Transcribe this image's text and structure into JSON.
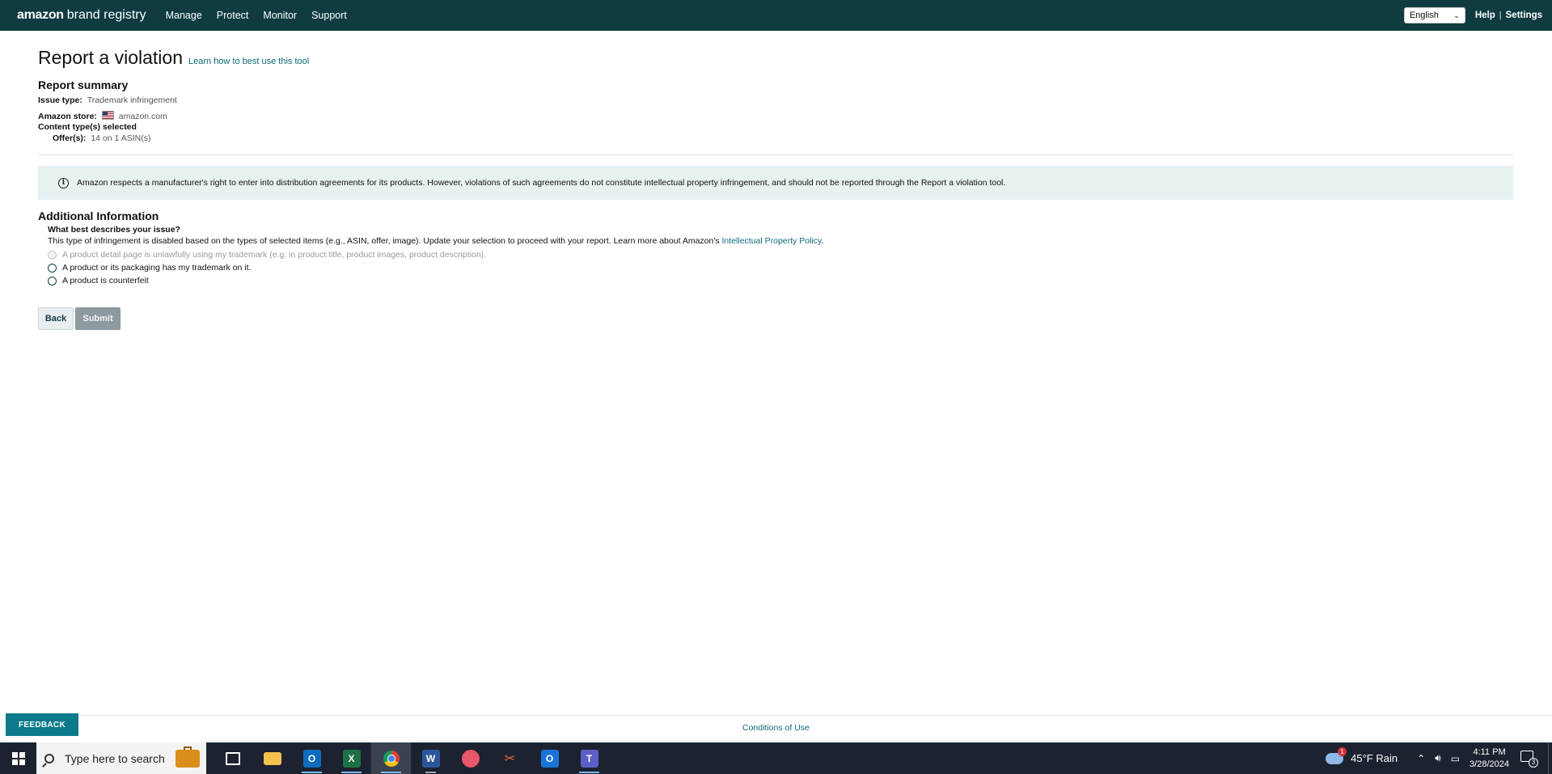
{
  "header": {
    "logo_main": "amazon",
    "logo_rest": "brand registry",
    "nav": [
      "Manage",
      "Protect",
      "Monitor",
      "Support"
    ],
    "language": "English",
    "help": "Help",
    "settings": "Settings",
    "brand_color": "#0f3b41"
  },
  "page": {
    "title": "Report a violation",
    "learn_link": "Learn how to best use this tool"
  },
  "summary": {
    "heading": "Report summary",
    "issue_type_label": "Issue type:",
    "issue_type_value": "Trademark infringement",
    "store_label": "Amazon store:",
    "store_value": "amazon.com",
    "content_label": "Content type(s) selected",
    "offers_label": "Offer(s):",
    "offers_value": "14 on 1 ASIN(s)"
  },
  "info": {
    "text": "Amazon respects a manufacturer's right to enter into distribution agreements for its products. However, violations of such agreements do not constitute intellectual property infringement, and should not be reported through the Report a violation tool."
  },
  "additional": {
    "heading": "Additional Information",
    "question": "What best describes your issue?",
    "disabled_note": "This type of infringement is disabled based on the types of selected items (e.g., ASIN, offer, image). Update your selection to proceed with your report. Learn more about Amazon's",
    "ip_policy_link": "Intellectual Property Policy",
    "ip_policy_period": ".",
    "options": [
      "A product detail page is unlawfully using my trademark (e.g. in product title, product images, product description).",
      "A product or its packaging has my trademark on it.",
      "A product is counterfeit"
    ]
  },
  "buttons": {
    "back": "Back",
    "submit": "Submit"
  },
  "footer": {
    "feedback": "FEEDBACK",
    "conditions": "Conditions of Use"
  },
  "taskbar": {
    "search_placeholder": "Type here to search",
    "weather_badge": "1",
    "weather": "45°F  Rain",
    "time": "4:11 PM",
    "date": "3/28/2024",
    "notifications": "3"
  }
}
